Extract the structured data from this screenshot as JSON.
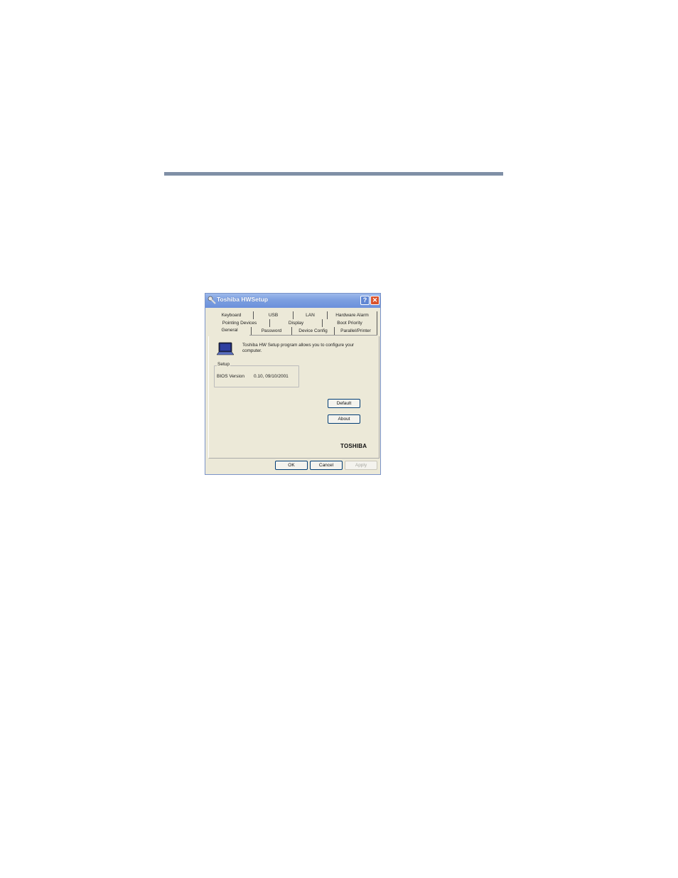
{
  "window": {
    "title": "Toshiba HWSetup",
    "help_label": "?",
    "close_label": "✕"
  },
  "tabs": {
    "row1": [
      "Keyboard",
      "USB",
      "LAN",
      "Hardware Alarm"
    ],
    "row2": [
      "Pointing Devices",
      "Display",
      "Boot Priority"
    ],
    "row3": [
      "General",
      "Password",
      "Device Config",
      "Parallel/Printer"
    ],
    "active": "General"
  },
  "general": {
    "description": "Toshiba HW Setup program allows you to configure your computer.",
    "setup_group_title": "Setup",
    "bios_label": "BIOS Version",
    "bios_value": "0.10, 09/10/2001",
    "default_button": "Default",
    "about_button": "About",
    "brand": "TOSHIBA"
  },
  "footer": {
    "ok_button": "OK",
    "cancel_button": "Cancel",
    "apply_button": "Apply"
  }
}
